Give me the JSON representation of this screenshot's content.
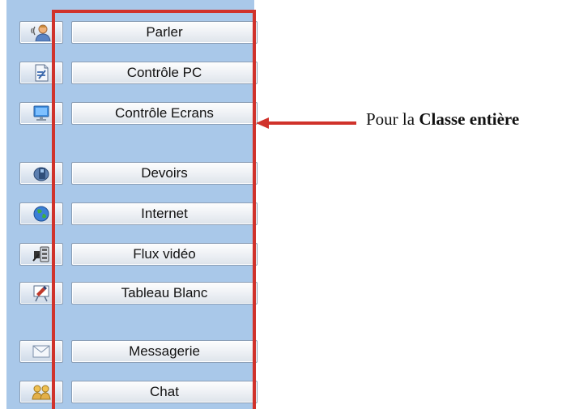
{
  "toolbar": {
    "items": [
      {
        "label": "Parler",
        "icon": "speaker-person-icon"
      },
      {
        "label": "Contrôle PC",
        "icon": "pc-document-icon"
      },
      {
        "label": "Contrôle Ecrans",
        "icon": "monitor-icon"
      },
      {
        "label": "Devoirs",
        "icon": "homework-icon"
      },
      {
        "label": "Internet",
        "icon": "globe-icon"
      },
      {
        "label": "Flux vidéo",
        "icon": "video-stream-icon"
      },
      {
        "label": "Tableau Blanc",
        "icon": "whiteboard-icon"
      },
      {
        "label": "Messagerie",
        "icon": "envelope-icon"
      },
      {
        "label": "Chat",
        "icon": "chat-users-icon"
      }
    ]
  },
  "annotation": {
    "prefix": "Pour la",
    "bold": "Classe entière"
  },
  "colors": {
    "panel_background": "#a9c8e9",
    "highlight": "#d0322b"
  }
}
